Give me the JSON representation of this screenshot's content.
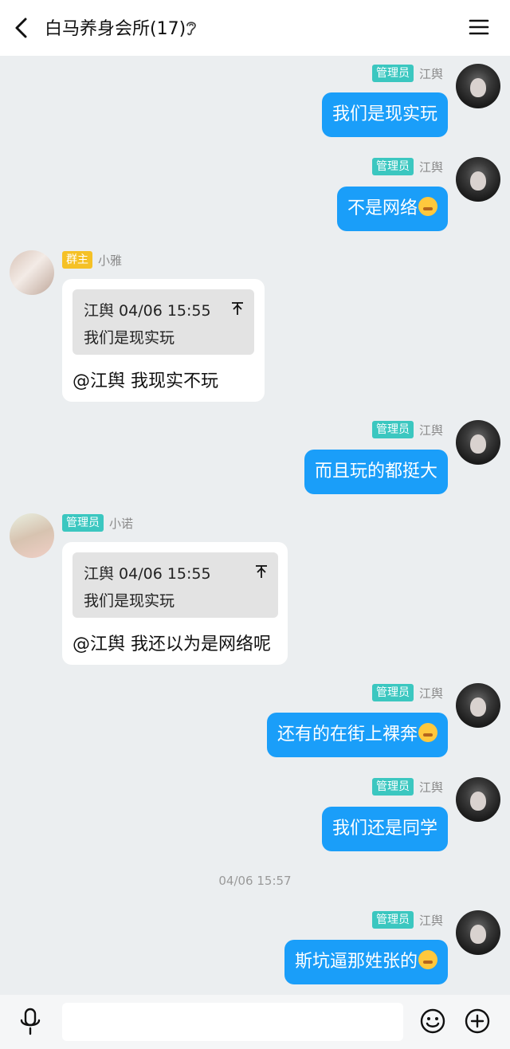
{
  "header": {
    "title": "白马养身会所(17)",
    "back_icon": "chevron-left-icon",
    "ear_icon": "ear-icon",
    "menu_icon": "hamburger-menu-icon"
  },
  "colors": {
    "self_bubble": "#1a9ef9",
    "admin_badge": "#3bc7c0",
    "owner_badge": "#f5c126",
    "background": "#ebeef0"
  },
  "messages": [
    {
      "side": "right",
      "badge": "管理员",
      "sender": "江舆",
      "text": "我们是现实玩"
    },
    {
      "side": "right",
      "badge": "管理员",
      "sender": "江舆",
      "text": "不是网络",
      "emoji": "grimace-emoji"
    },
    {
      "side": "left",
      "badge": "群主",
      "sender": "小雅",
      "quote": {
        "name": "江舆 04/06 15:55",
        "text": "我们是现实玩"
      },
      "text": "@江舆 我现实不玩"
    },
    {
      "side": "right",
      "badge": "管理员",
      "sender": "江舆",
      "text": "而且玩的都挺大"
    },
    {
      "side": "left",
      "badge": "管理员",
      "sender": "小诺",
      "quote": {
        "name": "江舆 04/06 15:55",
        "text": "我们是现实玩"
      },
      "text": "@江舆 我还以为是网络呢"
    },
    {
      "side": "right",
      "badge": "管理员",
      "sender": "江舆",
      "text": "还有的在街上裸奔",
      "emoji": "tongue-emoji"
    },
    {
      "side": "right",
      "badge": "管理员",
      "sender": "江舆",
      "text": "我们还是同学"
    },
    {
      "side": "right",
      "badge": "管理员",
      "sender": "江舆",
      "text": "斯坑逼那姓张的",
      "emoji": "grimace-emoji"
    }
  ],
  "timestamp": "04/06 15:57",
  "input_bar": {
    "mic_icon": "microphone-icon",
    "input_value": "",
    "emoji_icon": "smiley-icon",
    "plus_icon": "plus-circle-icon"
  }
}
